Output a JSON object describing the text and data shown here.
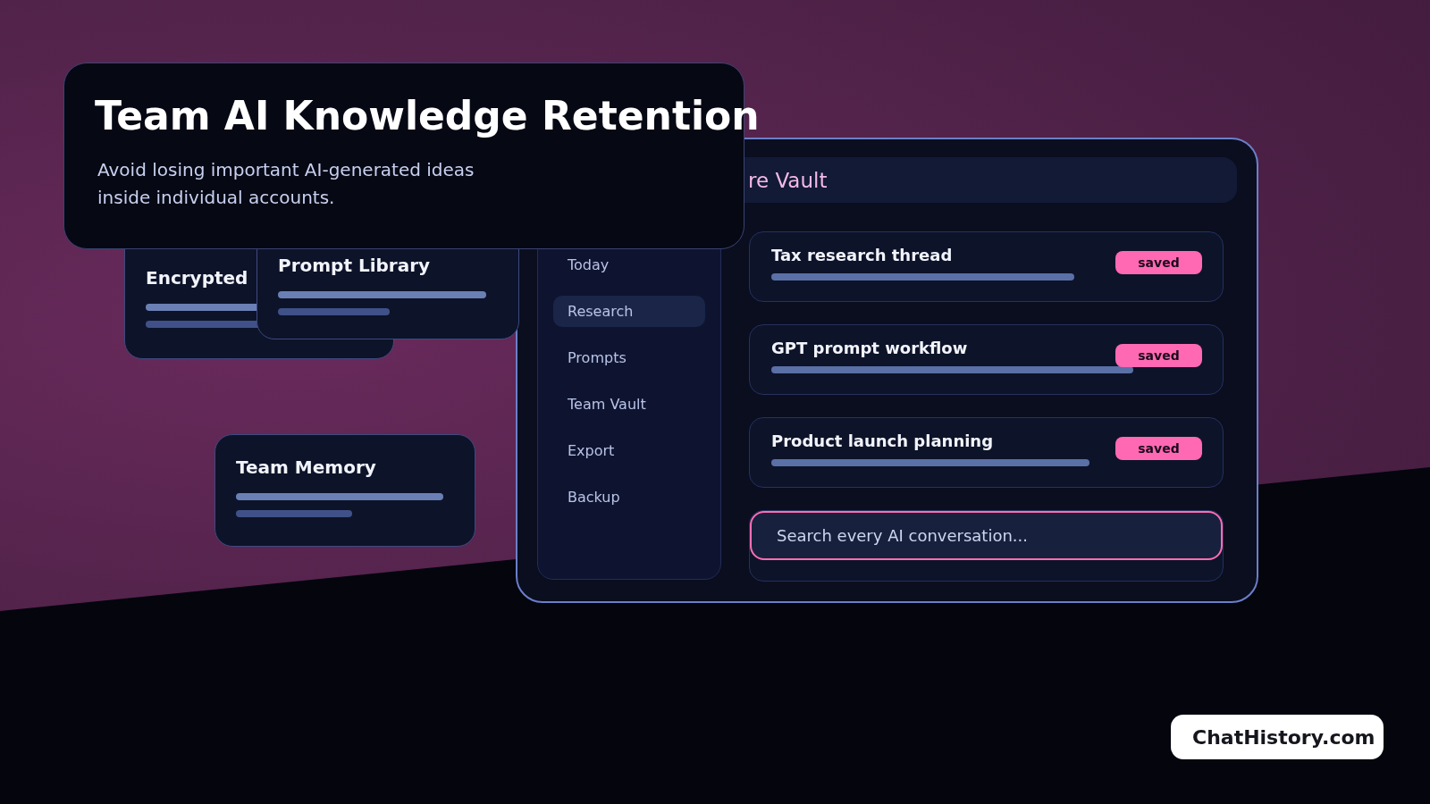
{
  "hero": {
    "title": "Team AI Knowledge Retention",
    "subtitle": "Avoid losing important AI-generated ideas\ninside individual accounts."
  },
  "feature_cards": [
    {
      "title": "Encrypted"
    },
    {
      "title": "Prompt Library"
    },
    {
      "title": "Team Memory"
    }
  ],
  "app_window": {
    "header": "re Vault",
    "nav_items": [
      {
        "label": "Today",
        "selected": false
      },
      {
        "label": "Research",
        "selected": true
      },
      {
        "label": "Prompts",
        "selected": false
      },
      {
        "label": "Team Vault",
        "selected": false
      },
      {
        "label": "Export",
        "selected": false
      },
      {
        "label": "Backup",
        "selected": false
      }
    ],
    "threads": [
      {
        "title": "Tax research thread",
        "badge": "saved"
      },
      {
        "title": "GPT prompt workflow",
        "badge": "saved"
      },
      {
        "title": "Product launch planning",
        "badge": "saved"
      }
    ],
    "search": {
      "placeholder": "Search every AI conversation..."
    }
  },
  "logo": {
    "text": "ChatHistory.com"
  }
}
